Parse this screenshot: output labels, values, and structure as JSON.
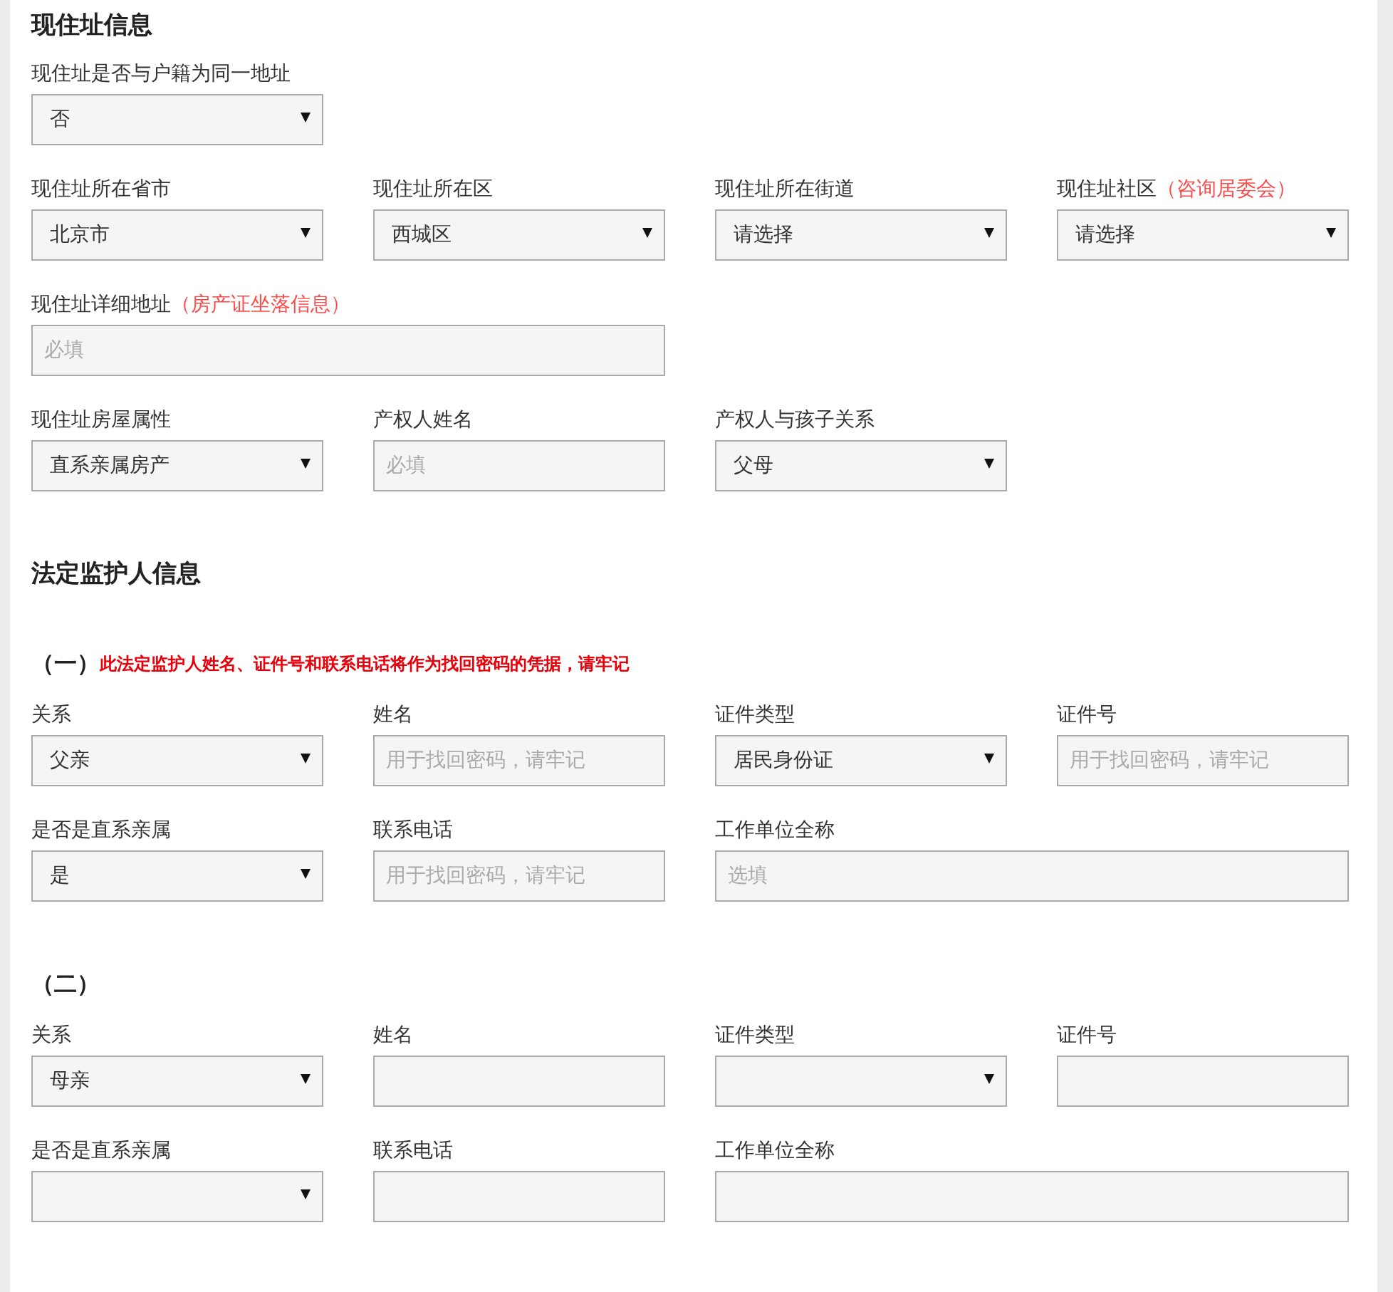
{
  "sections": [
    {
      "title": "现住址信息",
      "groups": [
        {
          "rows": [
            [
              {
                "label": "现住址是否与户籍为同一地址",
                "kind": "select",
                "value": "否",
                "wide": false
              }
            ],
            [
              {
                "label": "现住址所在省市",
                "kind": "select",
                "value": "北京市",
                "wide": false
              },
              {
                "label": "现住址所在区",
                "kind": "select",
                "value": "西城区",
                "wide": false
              },
              {
                "label": "现住址所在街道",
                "kind": "select",
                "value": "请选择",
                "wide": false
              },
              {
                "label": "现住址社区",
                "note": "（咨询居委会）",
                "kind": "select",
                "value": "请选择",
                "wide": false
              }
            ],
            [
              {
                "label": "现住址详细地址",
                "note": "（房产证坐落信息）",
                "kind": "input",
                "placeholder": "必填",
                "wide": true
              }
            ],
            [
              {
                "label": "现住址房屋属性",
                "kind": "select",
                "value": "直系亲属房产",
                "wide": false
              },
              {
                "label": "产权人姓名",
                "kind": "input",
                "placeholder": "必填",
                "wide": false
              },
              {
                "label": "产权人与孩子关系",
                "kind": "select",
                "value": "父母",
                "wide": false
              }
            ]
          ]
        }
      ]
    },
    {
      "title": "法定监护人信息",
      "groups": [
        {
          "heading": "（一）",
          "note": "此法定监护人姓名、证件号和联系电话将作为找回密码的凭据，请牢记",
          "rows": [
            [
              {
                "label": "关系",
                "kind": "select",
                "value": "父亲",
                "wide": false
              },
              {
                "label": "姓名",
                "kind": "input",
                "placeholder": "用于找回密码，请牢记",
                "wide": false
              },
              {
                "label": "证件类型",
                "kind": "select",
                "value": "居民身份证",
                "wide": false
              },
              {
                "label": "证件号",
                "kind": "input",
                "placeholder": "用于找回密码，请牢记",
                "wide": false
              }
            ],
            [
              {
                "label": "是否是直系亲属",
                "kind": "select",
                "value": "是",
                "wide": false
              },
              {
                "label": "联系电话",
                "kind": "input",
                "placeholder": "用于找回密码，请牢记",
                "wide": false
              },
              {
                "label": "工作单位全称",
                "kind": "input",
                "placeholder": "选填",
                "wide": true
              }
            ]
          ]
        },
        {
          "heading": "（二）",
          "rows": [
            [
              {
                "label": "关系",
                "kind": "select",
                "value": "母亲",
                "wide": false
              },
              {
                "label": "姓名",
                "kind": "input",
                "wide": false
              },
              {
                "label": "证件类型",
                "kind": "select",
                "wide": false
              },
              {
                "label": "证件号",
                "kind": "input",
                "wide": false
              }
            ],
            [
              {
                "label": "是否是直系亲属",
                "kind": "select",
                "wide": false
              },
              {
                "label": "联系电话",
                "kind": "input",
                "wide": false
              },
              {
                "label": "工作单位全称",
                "kind": "input",
                "wide": true
              }
            ]
          ]
        }
      ]
    }
  ]
}
